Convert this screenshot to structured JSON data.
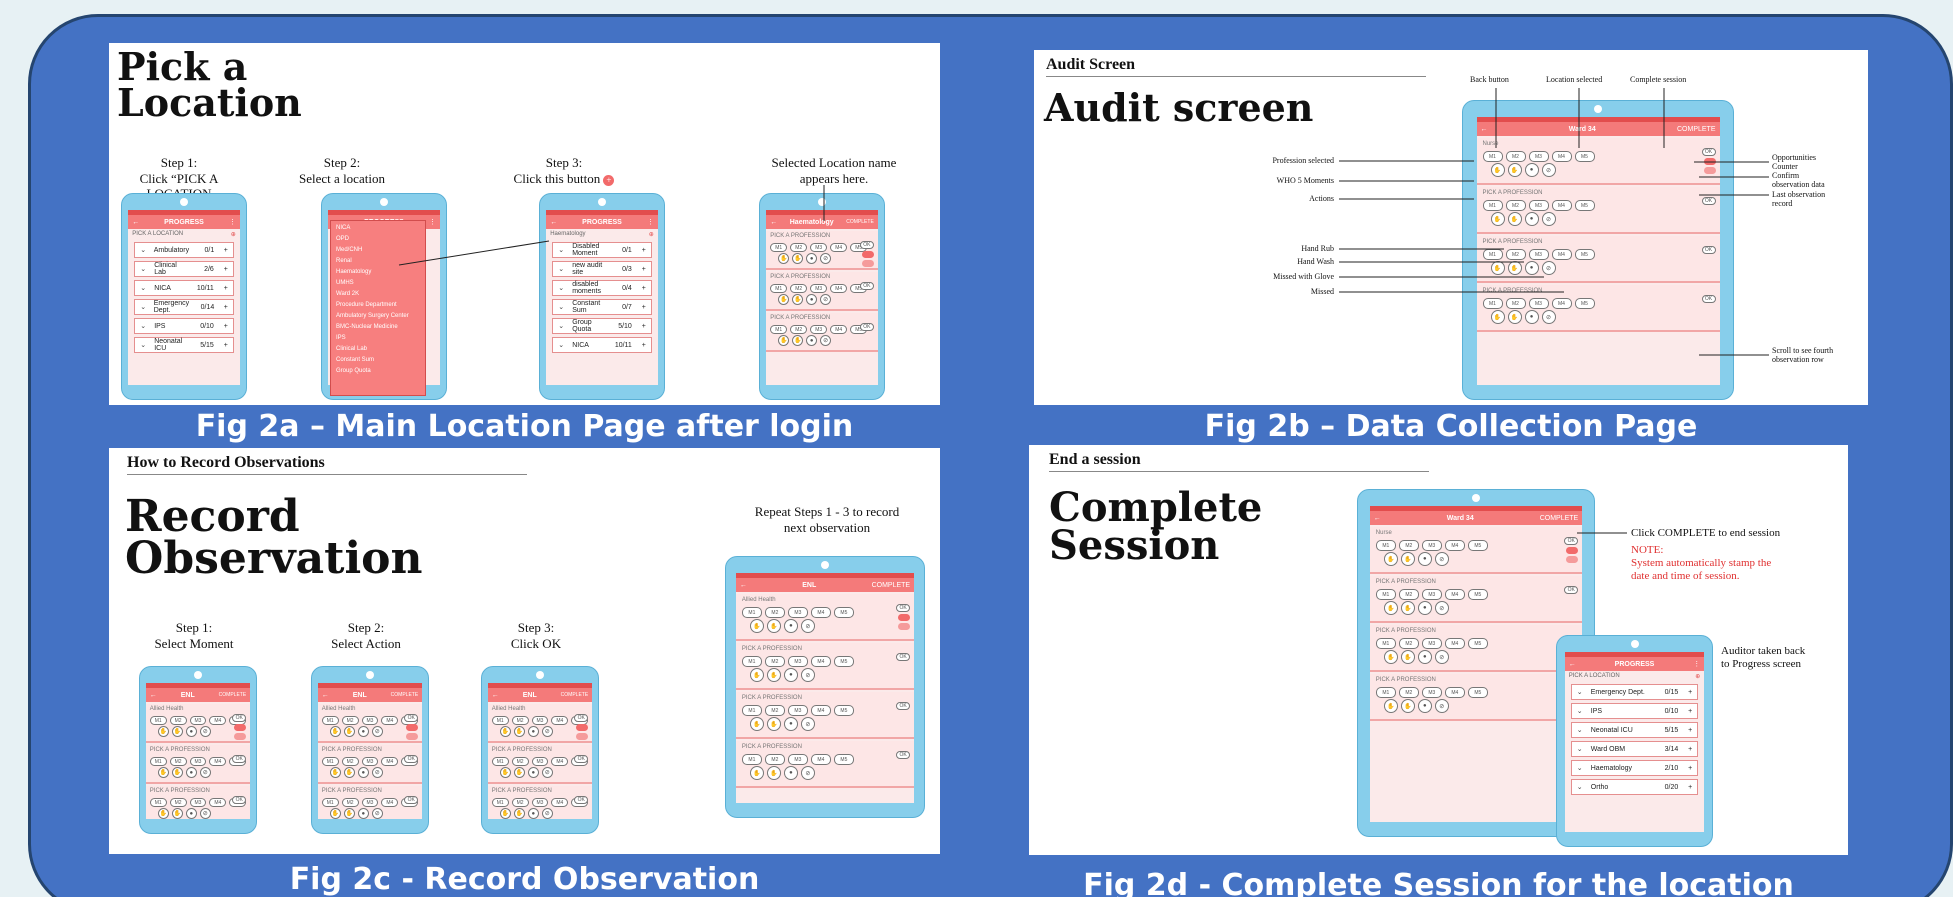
{
  "captions": {
    "a": "Fig 2a – Main Location Page after login",
    "b": "Fig 2b – Data Collection Page",
    "c": "Fig 2c - Record Observation",
    "d": "Fig 2d - Complete Session for the location"
  },
  "panel_a": {
    "title_line1": "Pick a",
    "title_line2": "Location",
    "step1_line1": "Step 1:",
    "step1_line2": "Click “PICK A LOCATION",
    "step2_line1": "Step 2:",
    "step2_line2": "Select a location",
    "step3_line1": "Step 3:",
    "step3_line2": "Click this button",
    "step4_line1": "Selected Location name",
    "step4_line2": "appears here.",
    "progress_title": "PROGRESS",
    "pick_location": "PICK A LOCATION",
    "phone1_rows": [
      {
        "name": "Ambulatory",
        "count": "0/1"
      },
      {
        "name": "Clinical Lab",
        "count": "2/6"
      },
      {
        "name": "NICA",
        "count": "10/11"
      },
      {
        "name": "Emergency Dept.",
        "count": "0/14"
      },
      {
        "name": "IPS",
        "count": "0/10"
      },
      {
        "name": "Neonatal ICU",
        "count": "5/15"
      }
    ],
    "dropdown_items": [
      "NICA",
      "OPD",
      "Med/CNH",
      "Renal",
      "Haematology",
      "UMHS",
      "Ward 2K",
      "Procedure Department",
      "Ambulatory Surgery Center",
      "BMC-Nuclear Medicine",
      "IPS",
      "Clinical Lab",
      "Constant Sum",
      "Group Quota"
    ],
    "selected": "Haematology",
    "phone3_rows": [
      {
        "name": "Disabled Moment",
        "count": "0/1"
      },
      {
        "name": "new audit site",
        "count": "0/3"
      },
      {
        "name": "disabled moments",
        "count": "0/4"
      },
      {
        "name": "Constant Sum",
        "count": "0/7"
      },
      {
        "name": "Group Quota",
        "count": "5/10"
      },
      {
        "name": "NICA",
        "count": "10/11"
      }
    ],
    "phone4_bar": "Haematology",
    "pick_profession": "PICK A PROFESSION"
  },
  "panel_b": {
    "section": "Audit Screen",
    "title": "Audit screen",
    "ann_back": "Back button",
    "ann_loc": "Location selected",
    "ann_complete": "Complete session",
    "ann_prof": "Profession selected",
    "ann_who": "WHO 5 Moments",
    "ann_actions": "Actions",
    "ann_hand_rub": "Hand Rub",
    "ann_hand_wash": "Hand Wash",
    "ann_missed_glove": "Missed with Glove",
    "ann_missed": "Missed",
    "ann_opp_l1": "Opportunities",
    "ann_opp_l2": "Counter",
    "ann_confirm_l1": "Confirm",
    "ann_confirm_l2": "observation data",
    "ann_last_l1": "Last observation",
    "ann_last_l2": "record",
    "ann_scroll_l1": "Scroll to see fourth",
    "ann_scroll_l2": "observation row",
    "bar_title": "Ward 34",
    "bar_right": "COMPLETE",
    "first_profession": "Nurse",
    "pick_profession": "PICK A PROFESSION"
  },
  "panel_c": {
    "section": "How to Record Observations",
    "title_line1": "Record",
    "title_line2": "Observation",
    "repeat_l1": "Repeat Steps 1 - 3 to record",
    "repeat_l2": "next observation",
    "s1_l1": "Step 1:",
    "s1_l2": "Select Moment",
    "s2_l1": "Step 2:",
    "s2_l2": "Select Action",
    "s3_l1": "Step 3:",
    "s3_l2": "Click OK",
    "bar_title": "ENL",
    "bar_right": "COMPLETE",
    "first_profession": "Allied Health",
    "pick_profession": "PICK A PROFESSION"
  },
  "panel_d": {
    "section": "End a session",
    "title_line1": "Complete",
    "title_line2": "Session",
    "click_complete": "Click COMPLETE to end session",
    "note_l1": "NOTE:",
    "note_l2": "System automatically stamp the",
    "note_l3": "date and time of session.",
    "auditor_l1": "Auditor taken back",
    "auditor_l2": "to Progress screen",
    "bar_title": "Ward 34",
    "bar_right": "COMPLETE",
    "first_profession": "Nurse",
    "pick_profession": "PICK A PROFESSION",
    "progress_title": "PROGRESS",
    "pick_location": "PICK A LOCATION",
    "progress_rows": [
      {
        "name": "Emergency Dept.",
        "count": "0/15"
      },
      {
        "name": "IPS",
        "count": "0/10"
      },
      {
        "name": "Neonatal ICU",
        "count": "5/15"
      },
      {
        "name": "Ward OBM",
        "count": "3/14"
      },
      {
        "name": "Haematology",
        "count": "2/10"
      },
      {
        "name": "Ortho",
        "count": "0/20"
      }
    ]
  },
  "moments": [
    "M1",
    "M2",
    "M3",
    "M4",
    "M5"
  ],
  "ok_label": "OK",
  "colors": {
    "frame": "#4472c4",
    "app_bar": "#f47a7a",
    "phone": "#87ceeb"
  }
}
